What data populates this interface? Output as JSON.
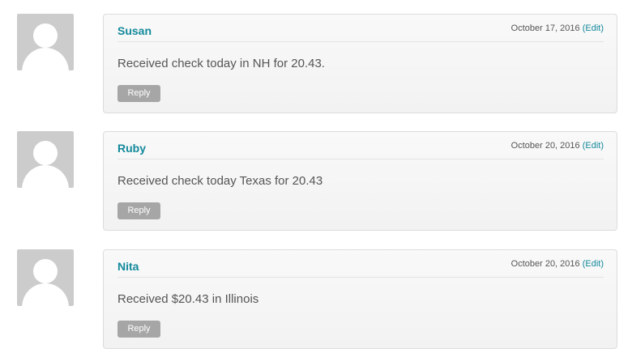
{
  "comments": [
    {
      "author": "Susan",
      "date": "October 17, 2016",
      "edit_label": "(Edit)",
      "text": "Received check today in NH for 20.43.",
      "reply_label": "Reply"
    },
    {
      "author": "Ruby",
      "date": "October 20, 2016",
      "edit_label": "(Edit)",
      "text": "Received check today Texas for 20.43",
      "reply_label": "Reply"
    },
    {
      "author": "Nita",
      "date": "October 20, 2016",
      "edit_label": "(Edit)",
      "text": "Received $20.43 in Illinois",
      "reply_label": "Reply"
    }
  ],
  "colors": {
    "link": "#13899b",
    "avatar_bg": "#cccccc",
    "reply_bg": "#a6a6a6"
  },
  "icons": {
    "avatar": "user-silhouette-icon"
  }
}
